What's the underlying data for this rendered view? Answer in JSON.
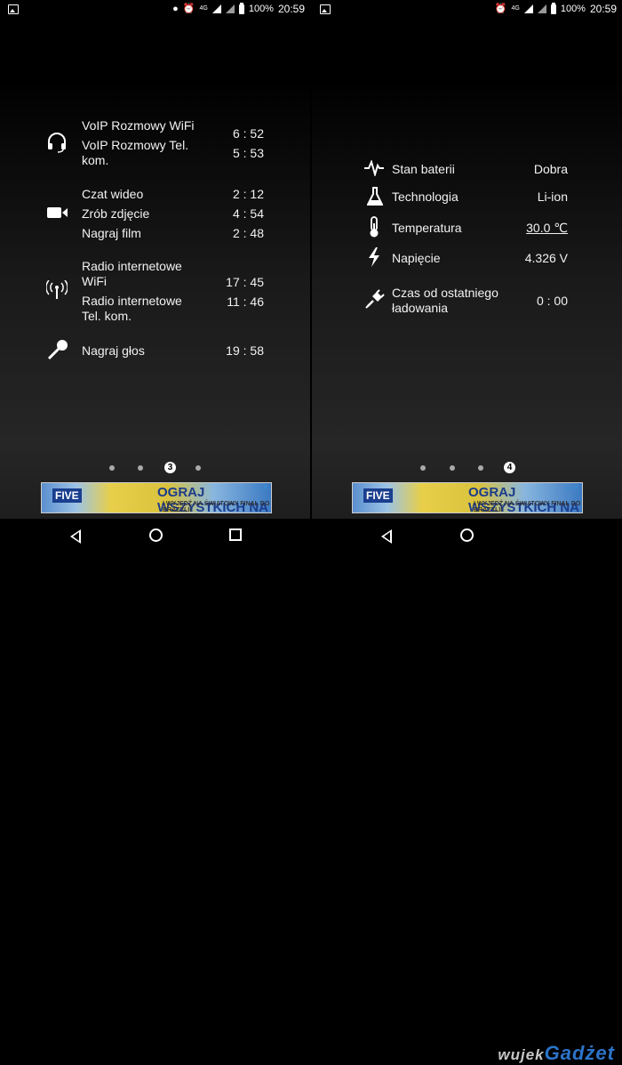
{
  "status": {
    "battery": "100%",
    "time": "20:59",
    "network": "4G"
  },
  "left": {
    "voip": {
      "items": [
        {
          "label": "VoIP Rozmowy WiFi",
          "value": "6 : 52"
        },
        {
          "label": "VoIP Rozmowy Tel. kom.",
          "value": "5 : 53"
        }
      ]
    },
    "video": {
      "items": [
        {
          "label": "Czat wideo",
          "value": "2 : 12"
        },
        {
          "label": "Zrób zdjęcie",
          "value": "4 : 54"
        },
        {
          "label": "Nagraj film",
          "value": "2 : 48"
        }
      ]
    },
    "radio": {
      "items": [
        {
          "label": "Radio internetowe WiFi",
          "value": "17 : 45"
        },
        {
          "label": "Radio internetowe Tel. kom.",
          "value": "11 : 46"
        }
      ]
    },
    "voice": {
      "items": [
        {
          "label": "Nagraj głos",
          "value": "19 : 58"
        }
      ]
    },
    "page_indicator": "3"
  },
  "right": {
    "items": [
      {
        "label": "Stan baterii",
        "value": "Dobra"
      },
      {
        "label": "Technologia",
        "value": "Li-ion"
      },
      {
        "label": "Temperatura",
        "value": "30.0 ℃"
      },
      {
        "label": "Napięcie",
        "value": "4.326 V"
      },
      {
        "label": "Czas od ostatniego ładowania",
        "value": "0 : 00"
      }
    ],
    "page_indicator": "4"
  },
  "ad": {
    "brand": "FIVE",
    "headline": "OGRAJ WSZYSTKICH NA PAKA",
    "sub": "I WYJEDŹ NA ŚWIATOWY FINAŁ DO BRAZYLII"
  },
  "watermark": {
    "prefix": "wujek",
    "name": "Gadżet"
  }
}
